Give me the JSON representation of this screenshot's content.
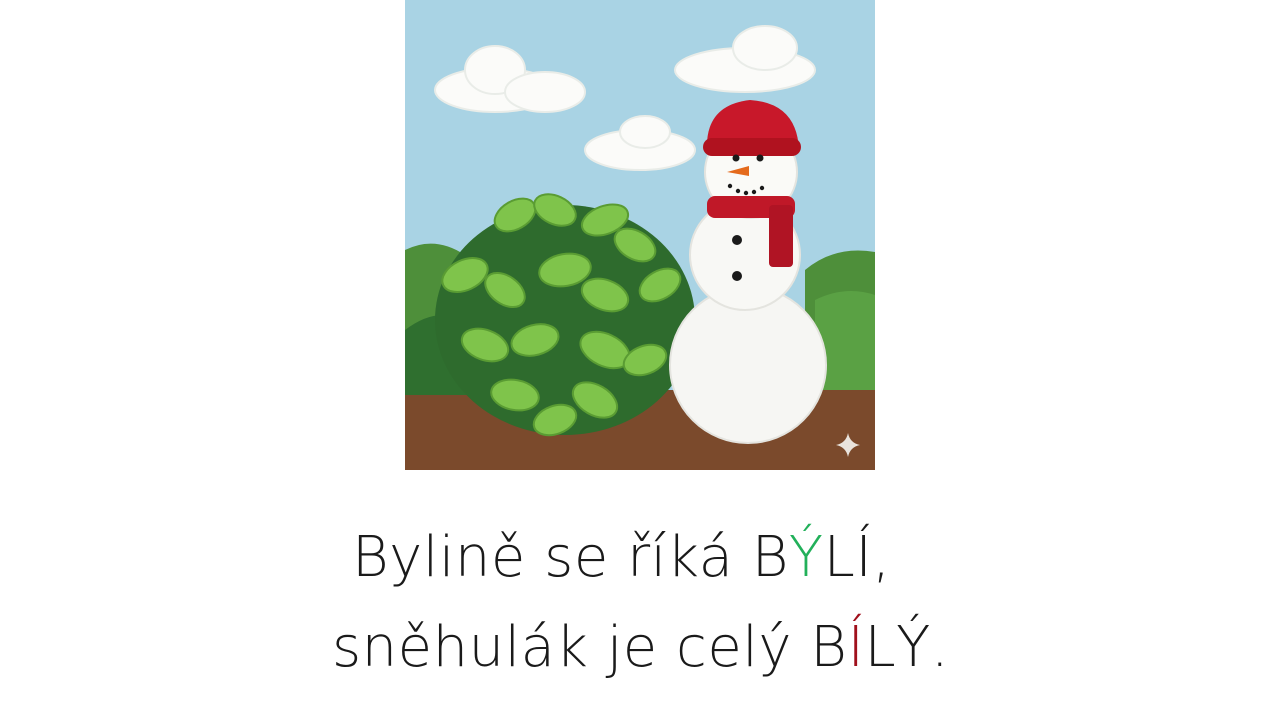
{
  "caption": {
    "line1": {
      "before": "Bylině se říká B",
      "highlight": "Ý",
      "after": "LÍ,"
    },
    "line2": {
      "before": "sněhulák je celý B",
      "highlight": "Í",
      "after": "LÝ."
    }
  },
  "colors": {
    "highlight_line1": "#22b05a",
    "highlight_line2": "#a0101c",
    "text": "#1a1a1a",
    "sky": "#a9d3e4",
    "soil": "#7b4a2c"
  },
  "picture": {
    "subject": "felt snowman with red hat and scarf beside green mint plant",
    "icons": [
      "sparkle-icon"
    ]
  }
}
